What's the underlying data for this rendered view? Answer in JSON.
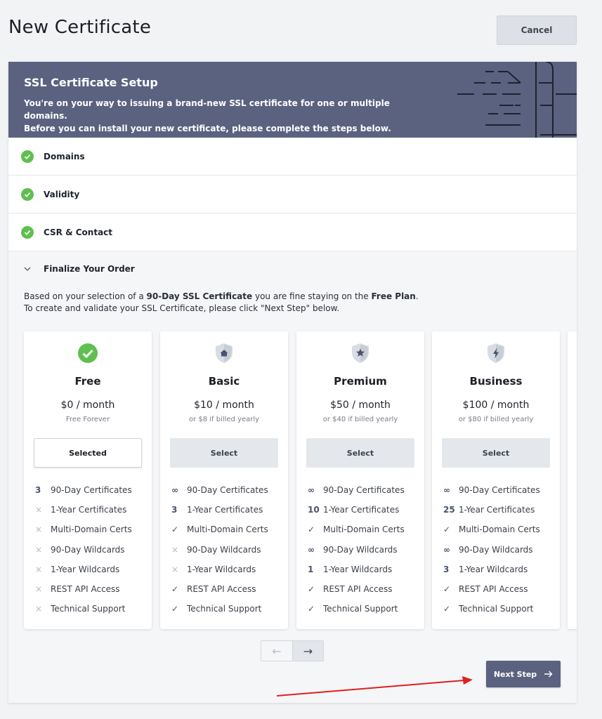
{
  "header": {
    "title": "New Certificate",
    "cancel_label": "Cancel"
  },
  "banner": {
    "title": "SSL Certificate Setup",
    "line1": "You're on your way to issuing a brand-new SSL certificate for one or multiple domains.",
    "line2": "Before you can install your new certificate, please complete the steps below."
  },
  "steps": [
    {
      "label": "Domains",
      "status": "complete"
    },
    {
      "label": "Validity",
      "status": "complete"
    },
    {
      "label": "CSR & Contact",
      "status": "complete"
    },
    {
      "label": "Finalize Your Order",
      "status": "expanded"
    }
  ],
  "finalize": {
    "desc_prefix": "Based on your selection of a ",
    "desc_cert": "90-Day SSL Certificate",
    "desc_mid": " you are fine staying on the ",
    "desc_plan": "Free Plan",
    "desc_end": ".",
    "desc_line2": "To create and validate your SSL Certificate, please click \"Next Step\" below."
  },
  "plans": [
    {
      "name": "Free",
      "price": "$0 / month",
      "sub": "Free Forever",
      "button": "Selected",
      "selected": true,
      "icon": "check-circle-icon",
      "features": [
        {
          "mark": "3",
          "label": "90-Day Certificates"
        },
        {
          "mark": "×",
          "label": "1-Year Certificates"
        },
        {
          "mark": "×",
          "label": "Multi-Domain Certs"
        },
        {
          "mark": "×",
          "label": "90-Day Wildcards"
        },
        {
          "mark": "×",
          "label": "1-Year Wildcards"
        },
        {
          "mark": "×",
          "label": "REST API Access"
        },
        {
          "mark": "×",
          "label": "Technical Support"
        }
      ]
    },
    {
      "name": "Basic",
      "price": "$10 / month",
      "sub": "or $8 if billed yearly",
      "button": "Select",
      "selected": false,
      "icon": "home-shield-icon",
      "features": [
        {
          "mark": "∞",
          "label": "90-Day Certificates"
        },
        {
          "mark": "3",
          "label": "1-Year Certificates"
        },
        {
          "mark": "✓",
          "label": "Multi-Domain Certs"
        },
        {
          "mark": "×",
          "label": "90-Day Wildcards"
        },
        {
          "mark": "×",
          "label": "1-Year Wildcards"
        },
        {
          "mark": "✓",
          "label": "REST API Access"
        },
        {
          "mark": "✓",
          "label": "Technical Support"
        }
      ]
    },
    {
      "name": "Premium",
      "price": "$50 / month",
      "sub": "or $40 if billed yearly",
      "button": "Select",
      "selected": false,
      "icon": "star-shield-icon",
      "features": [
        {
          "mark": "∞",
          "label": "90-Day Certificates"
        },
        {
          "mark": "10",
          "label": "1-Year Certificates"
        },
        {
          "mark": "✓",
          "label": "Multi-Domain Certs"
        },
        {
          "mark": "∞",
          "label": "90-Day Wildcards"
        },
        {
          "mark": "1",
          "label": "1-Year Wildcards"
        },
        {
          "mark": "✓",
          "label": "REST API Access"
        },
        {
          "mark": "✓",
          "label": "Technical Support"
        }
      ]
    },
    {
      "name": "Business",
      "price": "$100 / month",
      "sub": "or $80 if billed yearly",
      "button": "Select",
      "selected": false,
      "icon": "bolt-shield-icon",
      "features": [
        {
          "mark": "∞",
          "label": "90-Day Certificates"
        },
        {
          "mark": "25",
          "label": "1-Year Certificates"
        },
        {
          "mark": "✓",
          "label": "Multi-Domain Certs"
        },
        {
          "mark": "∞",
          "label": "90-Day Wildcards"
        },
        {
          "mark": "3",
          "label": "1-Year Wildcards"
        },
        {
          "mark": "✓",
          "label": "REST API Access"
        },
        {
          "mark": "✓",
          "label": "Technical Support"
        }
      ]
    }
  ],
  "pager": {
    "prev": "←",
    "next": "→"
  },
  "footer": {
    "next_label": "Next Step"
  },
  "colors": {
    "accent": "#5a6280",
    "success": "#5fbf4f",
    "annotation": "#e02020"
  }
}
